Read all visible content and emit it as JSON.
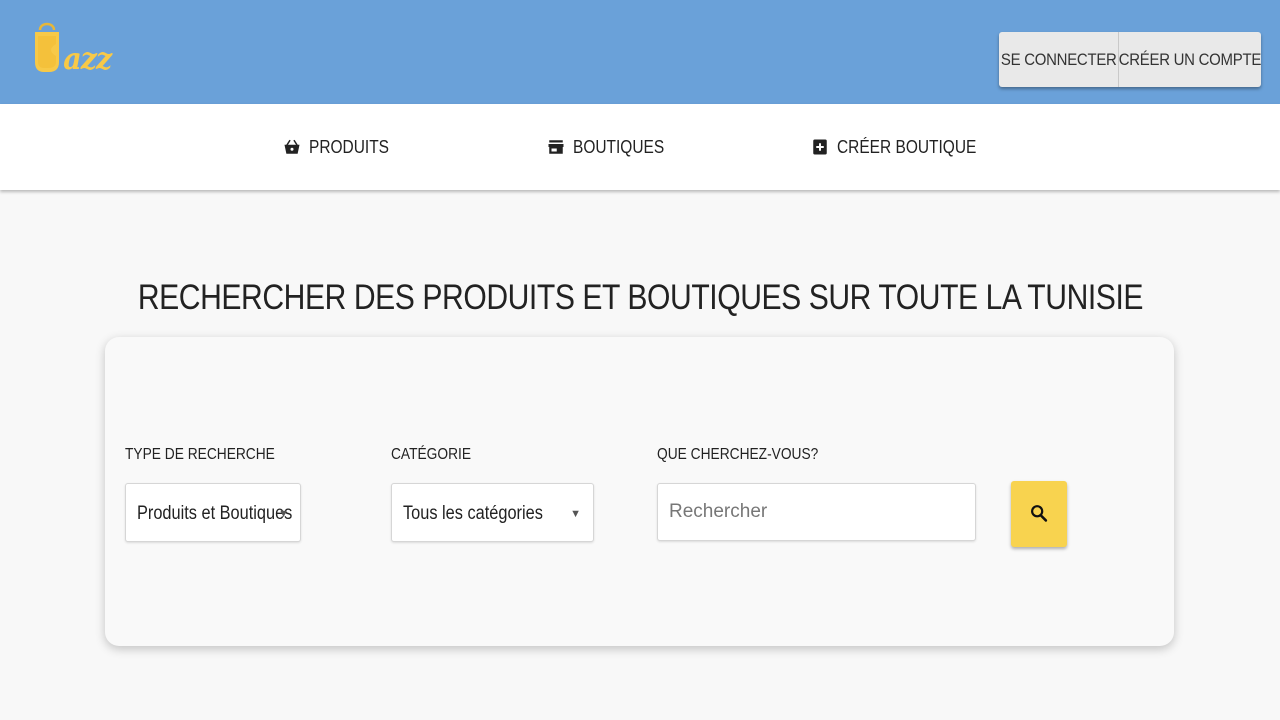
{
  "header": {
    "logo": {
      "text": "azz",
      "icon": "shopping-bag-icon",
      "color": "#f7c948"
    },
    "background": "#6aa1d9",
    "login_label": "SE CONNECTER",
    "register_label": "CRÉER UN COMPTE"
  },
  "nav": {
    "items": [
      {
        "label": "PRODUITS",
        "icon": "basket-icon"
      },
      {
        "label": "BOUTIQUES",
        "icon": "store-icon"
      },
      {
        "label": "CRÉER BOUTIQUE",
        "icon": "add-box-icon"
      }
    ]
  },
  "main": {
    "title": "RECHERCHER DES PRODUITS ET BOUTIQUES SUR TOUTE LA TUNISIE",
    "search": {
      "type_label": "TYPE DE RECHERCHE",
      "type_value": "Produits et Boutiques",
      "category_label": "CATÉGORIE",
      "category_value": "Tous les catégories",
      "query_label": "QUE CHERCHEZ-VOUS?",
      "query_placeholder": "Rechercher",
      "query_value": "",
      "button_icon": "search-icon",
      "button_color": "#f8d34f"
    }
  }
}
